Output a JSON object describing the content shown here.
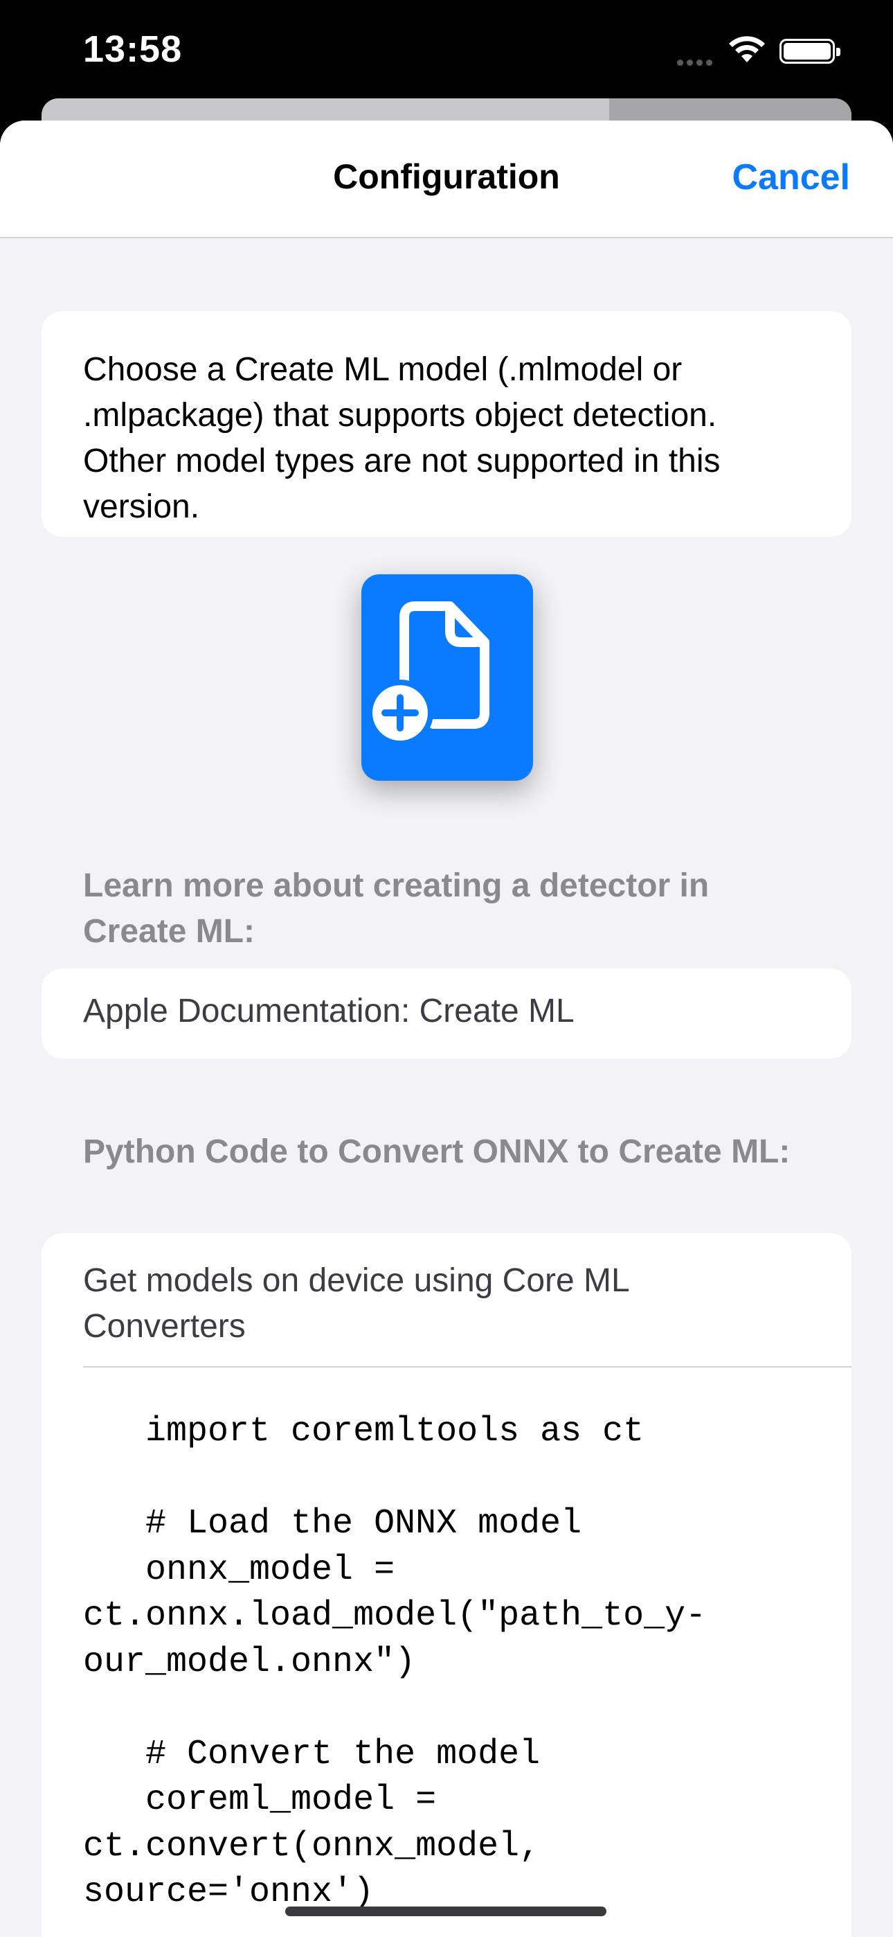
{
  "status_bar": {
    "time": "13:58"
  },
  "nav": {
    "title": "Configuration",
    "cancel_label": "Cancel"
  },
  "info_card": {
    "text": "Choose a Create ML model (.mlmodel or .mlpackage) that supports object detection. Other model types are not supported in this version."
  },
  "add_model_button": {
    "icon": "doc-badge-plus-icon",
    "color": "#0A7AFF"
  },
  "learn_more": {
    "header": "Learn more about creating a detector in Create ML:",
    "link_label": "Apple Documentation: Create ML"
  },
  "python_section": {
    "header": "Python Code to Convert ONNX to Create ML:",
    "link_label": "Get models on device using Core ML Converters",
    "code": "   import coremltools as ct\n\n   # Load the ONNX model\n   onnx_model =\nct.onnx.load_model(\"path_to_y-\nour_model.onnx\")\n\n   # Convert the model\n   coreml_model =\nct.convert(onnx_model,\nsource='onnx')"
  },
  "colors": {
    "accent": "#0A7AFF",
    "background": "#F2F2F7",
    "secondary_text": "#8A8A8E"
  }
}
